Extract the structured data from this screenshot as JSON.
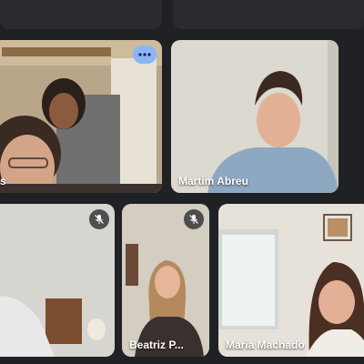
{
  "participants": [
    {
      "name": "s",
      "muted": false,
      "active": true
    },
    {
      "name": "Martim Abreu",
      "muted": false,
      "active": false
    },
    {
      "name": "",
      "muted": true,
      "active": false
    },
    {
      "name": "Beatriz P...",
      "muted": true,
      "active": false
    },
    {
      "name": "Maria Machado",
      "muted": false,
      "active": false
    }
  ],
  "icons": {
    "more_options": "more-options-icon",
    "mic_off": "mic-off-icon"
  },
  "colors": {
    "background": "#202124",
    "active_speaker_border": "#8ab4f8",
    "more_button": "#8ab4f8"
  }
}
